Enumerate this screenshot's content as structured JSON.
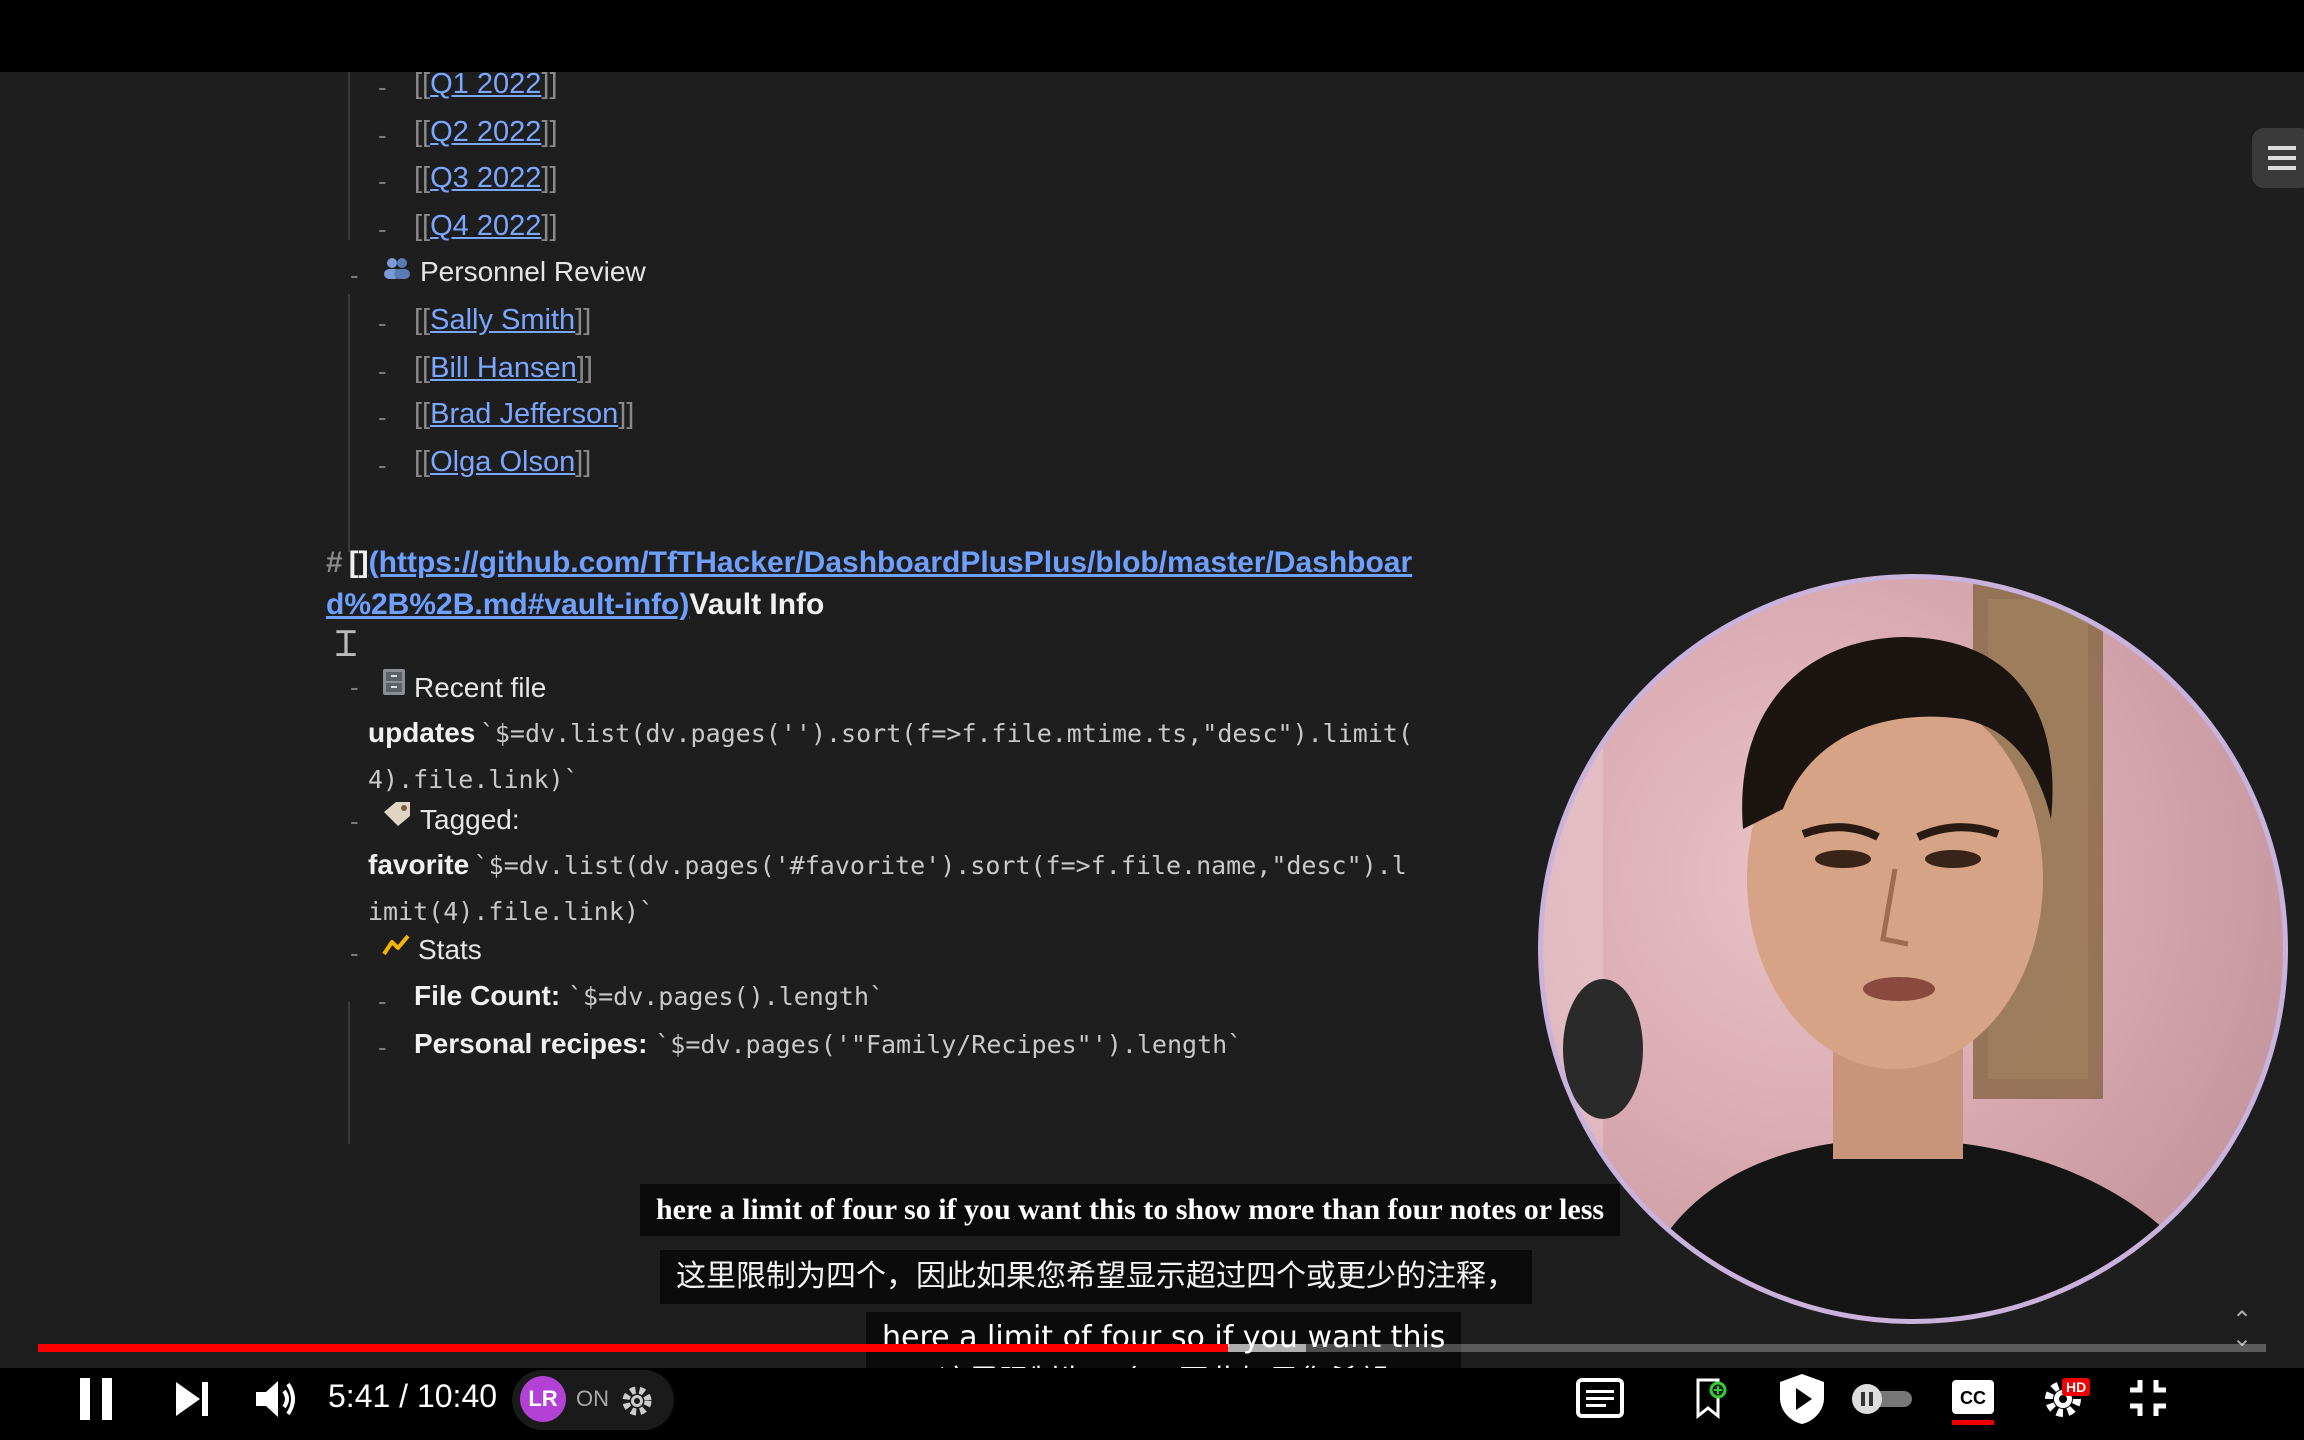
{
  "note": {
    "quarter_links": [
      "Q1 2022",
      "Q2 2022",
      "Q3 2022",
      "Q4 2022"
    ],
    "personnel_heading": "Personnel Review",
    "personnel_links": [
      "Sally Smith",
      "Bill Hansen",
      "Brad Jefferson",
      "Olga Olson"
    ],
    "link_open": "[[",
    "link_close": "]]",
    "dash": "-",
    "heading_hash": "#",
    "heading_box": "[]",
    "heading_url_1": "(https://github.com/TfTHacker/DashboardPlusPlus/blob/master/Dashboar",
    "heading_url_2": "d%2B%2B.md#vault-info)",
    "heading_title": "Vault Info",
    "recent_label": "Recent file",
    "recent_word": "updates",
    "recent_code_1": "`$=dv.list(dv.pages('').sort(f=>f.file.mtime.ts,\"desc\").limit(",
    "recent_code_2": "4).file.link)`",
    "tagged_label": "Tagged:",
    "tagged_word": "favorite",
    "tagged_code_1": "`$=dv.list(dv.pages('#favorite').sort(f=>f.file.name,\"desc\").l",
    "tagged_code_2": "imit(4).file.link)`",
    "stats_label": "Stats",
    "file_count_label": "File Count:",
    "file_count_code": "`$=dv.pages().length`",
    "recipes_label": "Personal recipes:",
    "recipes_code": "`$=dv.pages('\"Family/Recipes\"').length`"
  },
  "subtitles": {
    "english": "here a limit of four so if you want this to show more than four notes or less",
    "chinese": "这里限制为四个，因此如果您希望显示超过四个或更少的注释，",
    "auto_line_1": "here a limit of four so if you want this",
    "auto_line_2": "这里限制为四个，因此如果您希望"
  },
  "player": {
    "current_time": "5:41",
    "separator": " / ",
    "duration": "10:40",
    "progress_fraction": 0.534,
    "buffer_fraction": 0.569,
    "extension_logo": "LR",
    "extension_state": "ON",
    "hd_badge": "HD",
    "icons": [
      "pause-icon",
      "next-icon",
      "volume-icon",
      "gear-icon",
      "subtitles-panel-icon",
      "bookmark-add-icon",
      "shield-play-icon",
      "autoplay-toggle-icon",
      "cc-icon",
      "settings-icon",
      "exit-fullscreen-icon"
    ]
  },
  "colors": {
    "accent": "#ff0000",
    "link": "#7aa7ff",
    "note_bg": "#1e1e1e"
  }
}
